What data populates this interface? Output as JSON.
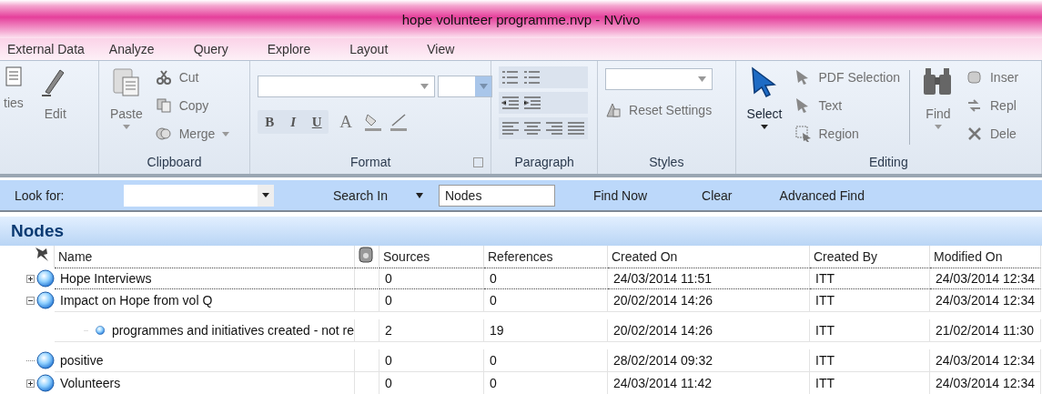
{
  "window": {
    "title": "hope volunteer programme.nvp - NVivo"
  },
  "menu_tabs": [
    {
      "label": "External Data"
    },
    {
      "label": "Analyze"
    },
    {
      "label": "Query"
    },
    {
      "label": "Explore"
    },
    {
      "label": "Layout"
    },
    {
      "label": "View"
    }
  ],
  "ribbon": {
    "groups": [
      {
        "kind": "buttons",
        "items": [
          {
            "kind": "large",
            "label": "ties",
            "disabled": true
          },
          {
            "kind": "large",
            "label": "Edit",
            "disabled": true
          }
        ]
      },
      {
        "kind": "buttons",
        "label": "Clipboard",
        "items": [
          {
            "kind": "large",
            "label": "Paste",
            "disabled": true,
            "dropdown": true
          },
          {
            "kind": "small",
            "label": "Cut",
            "disabled": true
          },
          {
            "kind": "small",
            "label": "Copy",
            "disabled": true
          },
          {
            "kind": "small",
            "label": "Merge",
            "disabled": true,
            "dropdown": true
          }
        ]
      },
      {
        "kind": "format",
        "label": "Format",
        "text_buttons": [
          "B",
          "I",
          "U",
          "A"
        ]
      },
      {
        "kind": "paragraph",
        "label": "Paragraph"
      },
      {
        "kind": "styles",
        "label": "Styles",
        "items": [
          {
            "kind": "small",
            "label": "Reset Settings",
            "disabled": true
          }
        ]
      },
      {
        "kind": "buttons",
        "label": "Editing",
        "items": [
          {
            "kind": "large",
            "label": "Select",
            "disabled": false,
            "dropdown": true
          },
          {
            "kind": "small",
            "label": "PDF Selection",
            "disabled": true
          },
          {
            "kind": "small",
            "label": "Text",
            "disabled": true
          },
          {
            "kind": "small",
            "label": "Region",
            "disabled": true
          },
          {
            "kind": "large",
            "label": "Find",
            "disabled": true,
            "dropdown": true
          },
          {
            "kind": "small",
            "label": "Inser",
            "disabled": true
          },
          {
            "kind": "small",
            "label": "Repl",
            "disabled": true
          },
          {
            "kind": "small",
            "label": "Dele",
            "disabled": true
          }
        ]
      }
    ]
  },
  "find_bar": {
    "look_for_label": "Look for:",
    "search_in_label": "Search In",
    "search_in_value": "Nodes",
    "buttons": [
      "Find Now",
      "Clear",
      "Advanced Find"
    ]
  },
  "nodes": {
    "title": "Nodes",
    "columns": [
      "Name",
      "Sources",
      "References",
      "Created On",
      "Created By",
      "Modified On"
    ],
    "rows": [
      {
        "name": "Hope Interviews",
        "kind": "collapsed",
        "selected": true,
        "sources": "0",
        "references": "0",
        "created_on": "24/03/2014 11:51",
        "created_by": "ITT",
        "modified_on": "24/03/2014 12:34"
      },
      {
        "name": "Impact on Hope from vol Q",
        "kind": "expanded",
        "selected": false,
        "sources": "0",
        "references": "0",
        "created_on": "20/02/2014 14:26",
        "created_by": "ITT",
        "modified_on": "24/03/2014 12:34",
        "children": [
          {
            "name": "programmes and initiatives created - not re",
            "kind": "leaf",
            "selected": false,
            "sources": "2",
            "references": "19",
            "created_on": "20/02/2014 14:26",
            "created_by": "ITT",
            "modified_on": "21/02/2014 11:30"
          }
        ]
      },
      {
        "name": "positive",
        "kind": "leaf",
        "selected": false,
        "sources": "0",
        "references": "0",
        "created_on": "28/02/2014 09:32",
        "created_by": "ITT",
        "modified_on": "24/03/2014 12:34"
      },
      {
        "name": "Volunteers",
        "kind": "collapsed",
        "selected": false,
        "sources": "0",
        "references": "0",
        "created_on": "24/03/2014 11:42",
        "created_by": "ITT",
        "modified_on": "24/03/2014 12:34"
      }
    ]
  }
}
